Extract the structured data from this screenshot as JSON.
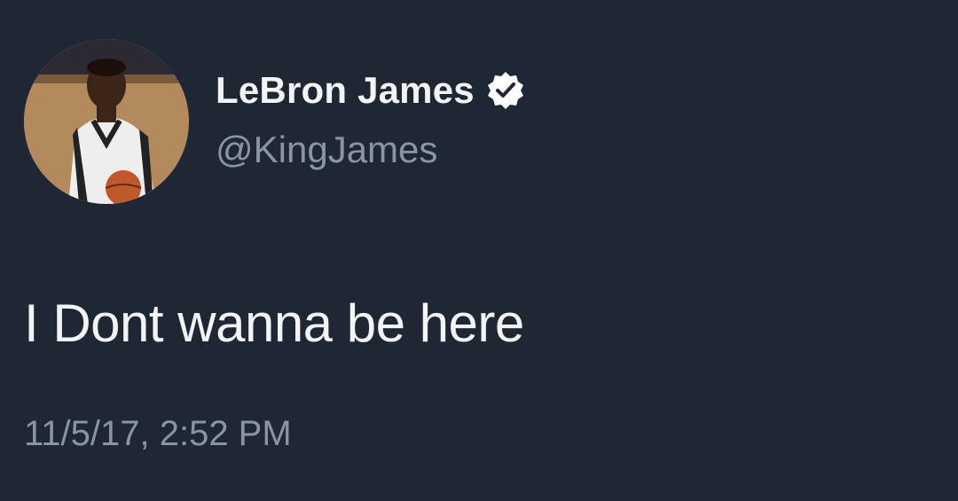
{
  "tweet": {
    "display_name": "LeBron James",
    "handle": "@KingJames",
    "text": "I Dont wanna be here",
    "timestamp": "11/5/17, 2:52 PM",
    "verified": true
  },
  "colors": {
    "background": "#1f2634",
    "name": "#f3f4f6",
    "secondary": "#8a95a3",
    "badge": "#ffffff"
  },
  "icons": {
    "avatar": "profile-photo",
    "verified": "verified-badge-icon"
  }
}
